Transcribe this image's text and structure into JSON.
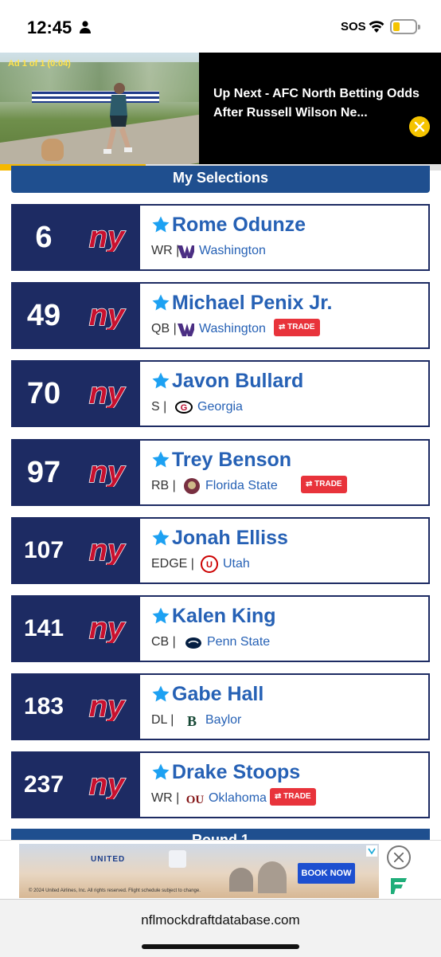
{
  "status_bar": {
    "time": "12:45",
    "sos": "SOS",
    "battery_color": "#f5c400"
  },
  "video_ad": {
    "ad_label": "Ad 1 of 1 (0:04)",
    "title": "Up Next - AFC North Betting Odds After Russell Wilson Ne...",
    "progress_fraction": 0.33
  },
  "section": {
    "title": "My Selections"
  },
  "team": {
    "logo_text": "ny",
    "colors": {
      "navy": "#1d2b63",
      "red": "#c8102e",
      "link": "#2661b5",
      "trade": "#e8333b"
    }
  },
  "picks": [
    {
      "pick": "6",
      "name": "Rome Odunze",
      "position": "WR |",
      "school": "Washington",
      "school_icon": "washington-logo",
      "trade": ""
    },
    {
      "pick": "49",
      "name": "Michael Penix Jr.",
      "position": "QB |",
      "school": "Washington",
      "school_icon": "washington-logo",
      "trade": "⇄ TRADE"
    },
    {
      "pick": "70",
      "name": "Javon Bullard",
      "position": "S |",
      "school": "Georgia",
      "school_icon": "georgia-logo",
      "trade": ""
    },
    {
      "pick": "97",
      "name": "Trey Benson",
      "position": "RB |",
      "school": "Florida State",
      "school_icon": "florida-state-logo",
      "trade": "⇄ TRADE"
    },
    {
      "pick": "107",
      "name": "Jonah Elliss",
      "position": "EDGE |",
      "school": "Utah",
      "school_icon": "utah-logo",
      "trade": ""
    },
    {
      "pick": "141",
      "name": "Kalen King",
      "position": "CB |",
      "school": "Penn State",
      "school_icon": "penn-state-logo",
      "trade": ""
    },
    {
      "pick": "183",
      "name": "Gabe Hall",
      "position": "DL |",
      "school": "Baylor",
      "school_icon": "baylor-logo",
      "trade": ""
    },
    {
      "pick": "237",
      "name": "Drake Stoops",
      "position": "WR |",
      "school": "Oklahoma",
      "school_icon": "oklahoma-logo",
      "trade": "⇄ TRADE"
    }
  ],
  "round_header": {
    "title": "Round 1"
  },
  "banner_ad": {
    "brand": "UNITED",
    "cta": "BOOK NOW",
    "fine_print": "© 2024 United Airlines, Inc. All rights reserved. Flight schedule subject to change."
  },
  "browser": {
    "url": "nflmockdraftdatabase.com"
  }
}
